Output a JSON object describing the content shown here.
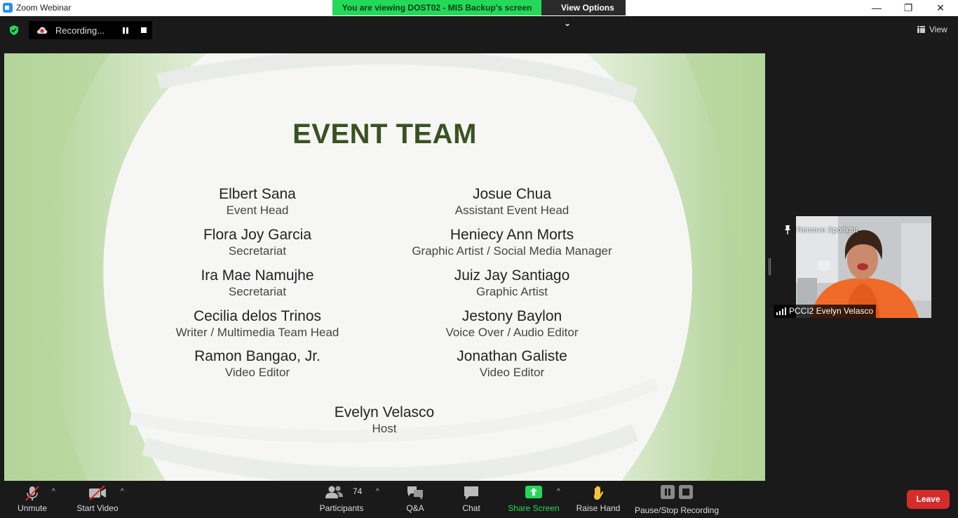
{
  "window": {
    "title": "Zoom Webinar",
    "minimize_glyph": "—",
    "maximize_glyph": "❐",
    "close_glyph": "✕"
  },
  "share_banner": {
    "text": "You are viewing DOST02 - MIS Backup's screen",
    "view_options": "View Options",
    "caret": "⌄"
  },
  "recording": {
    "label": "Recording..."
  },
  "view_button": {
    "label": "View"
  },
  "slide": {
    "title": "EVENT TEAM",
    "left_column": [
      {
        "name": "Elbert Sana",
        "role": "Event Head"
      },
      {
        "name": "Flora Joy Garcia",
        "role": "Secretariat"
      },
      {
        "name": "Ira Mae Namujhe",
        "role": "Secretariat"
      },
      {
        "name": "Cecilia delos Trinos",
        "role": "Writer / Multimedia Team Head"
      },
      {
        "name": "Ramon Bangao, Jr.",
        "role": "Video Editor"
      }
    ],
    "right_column": [
      {
        "name": "Josue Chua",
        "role": "Assistant Event Head"
      },
      {
        "name": "Heniecy Ann Morts",
        "role": "Graphic Artist / Social Media Manager"
      },
      {
        "name": "Juiz Jay Santiago",
        "role": "Graphic Artist"
      },
      {
        "name": "Jestony Baylon",
        "role": "Voice Over / Audio Editor"
      },
      {
        "name": "Jonathan Galiste",
        "role": "Video Editor"
      }
    ],
    "host": {
      "name": "Evelyn Velasco",
      "role": "Host"
    }
  },
  "video": {
    "spotlight_label": "Remove Spotlight",
    "participant_name": "PCCI2 Evelyn Velasco"
  },
  "toolbar": {
    "unmute": "Unmute",
    "start_video": "Start Video",
    "participants": "Participants",
    "participants_count": "74",
    "qa": "Q&A",
    "chat": "Chat",
    "share_screen": "Share Screen",
    "raise_hand": "Raise Hand",
    "pause_stop_recording": "Pause/Stop Recording",
    "leave": "Leave",
    "caret": "^"
  },
  "colors": {
    "share_green": "#23d959",
    "leave_red": "#d52b2b",
    "slide_title": "#3a5222"
  }
}
